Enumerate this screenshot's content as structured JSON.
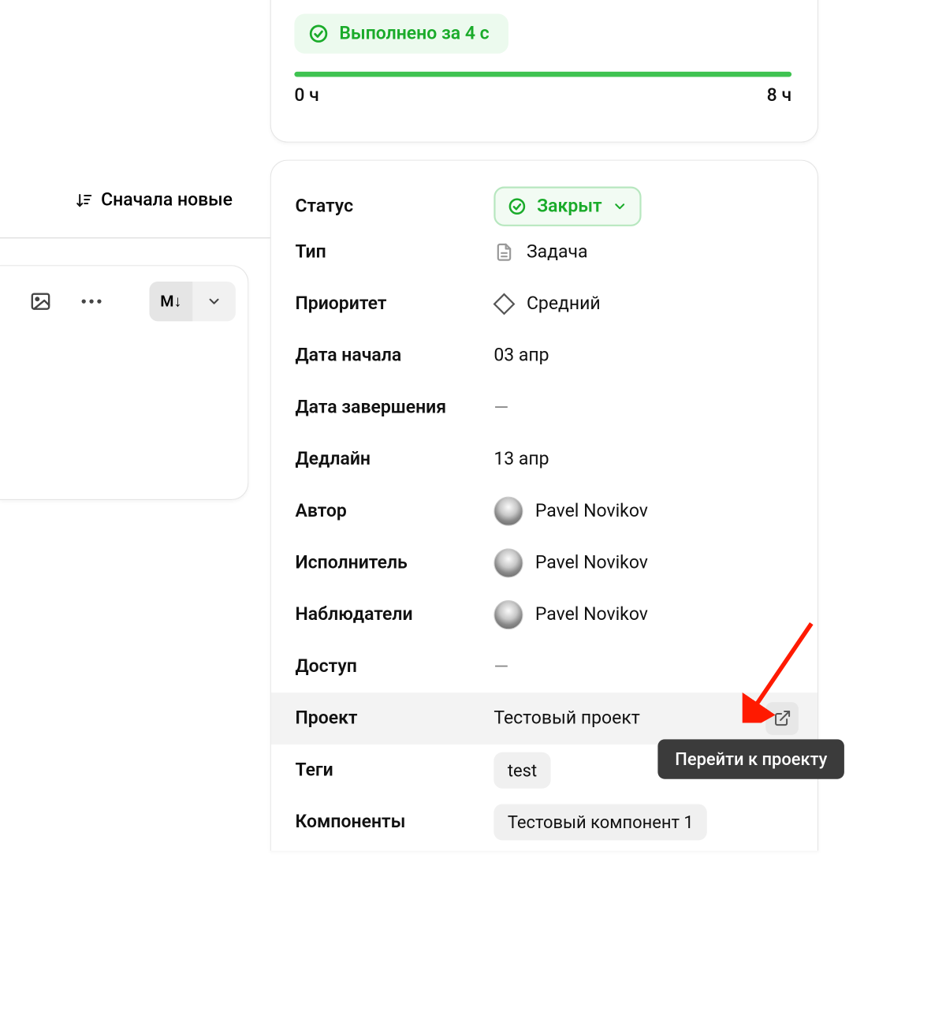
{
  "sort": {
    "label": "Сначала новые"
  },
  "toolbar": {
    "md_label": "M↓"
  },
  "progress": {
    "chip": "Выполнено за 4 с",
    "start": "0 ч",
    "end": "8 ч"
  },
  "fields": {
    "status": {
      "label": "Статус",
      "value": "Закрыт"
    },
    "type": {
      "label": "Тип",
      "value": "Задача"
    },
    "priority": {
      "label": "Приоритет",
      "value": "Средний"
    },
    "start_date": {
      "label": "Дата начала",
      "value": "03 апр"
    },
    "end_date": {
      "label": "Дата завершения",
      "value": "—"
    },
    "deadline": {
      "label": "Дедлайн",
      "value": "13 апр"
    },
    "author": {
      "label": "Автор",
      "value": "Pavel Novikov"
    },
    "assignee": {
      "label": "Исполнитель",
      "value": "Pavel Novikov"
    },
    "watchers": {
      "label": "Наблюдатели",
      "value": "Pavel Novikov"
    },
    "access": {
      "label": "Доступ",
      "value": "—"
    },
    "project": {
      "label": "Проект",
      "value": "Тестовый проект"
    },
    "tags": {
      "label": "Теги",
      "value": "test"
    },
    "components": {
      "label": "Компоненты",
      "value": "Тестовый компонент 1"
    }
  },
  "tooltip": "Перейти к проекту"
}
